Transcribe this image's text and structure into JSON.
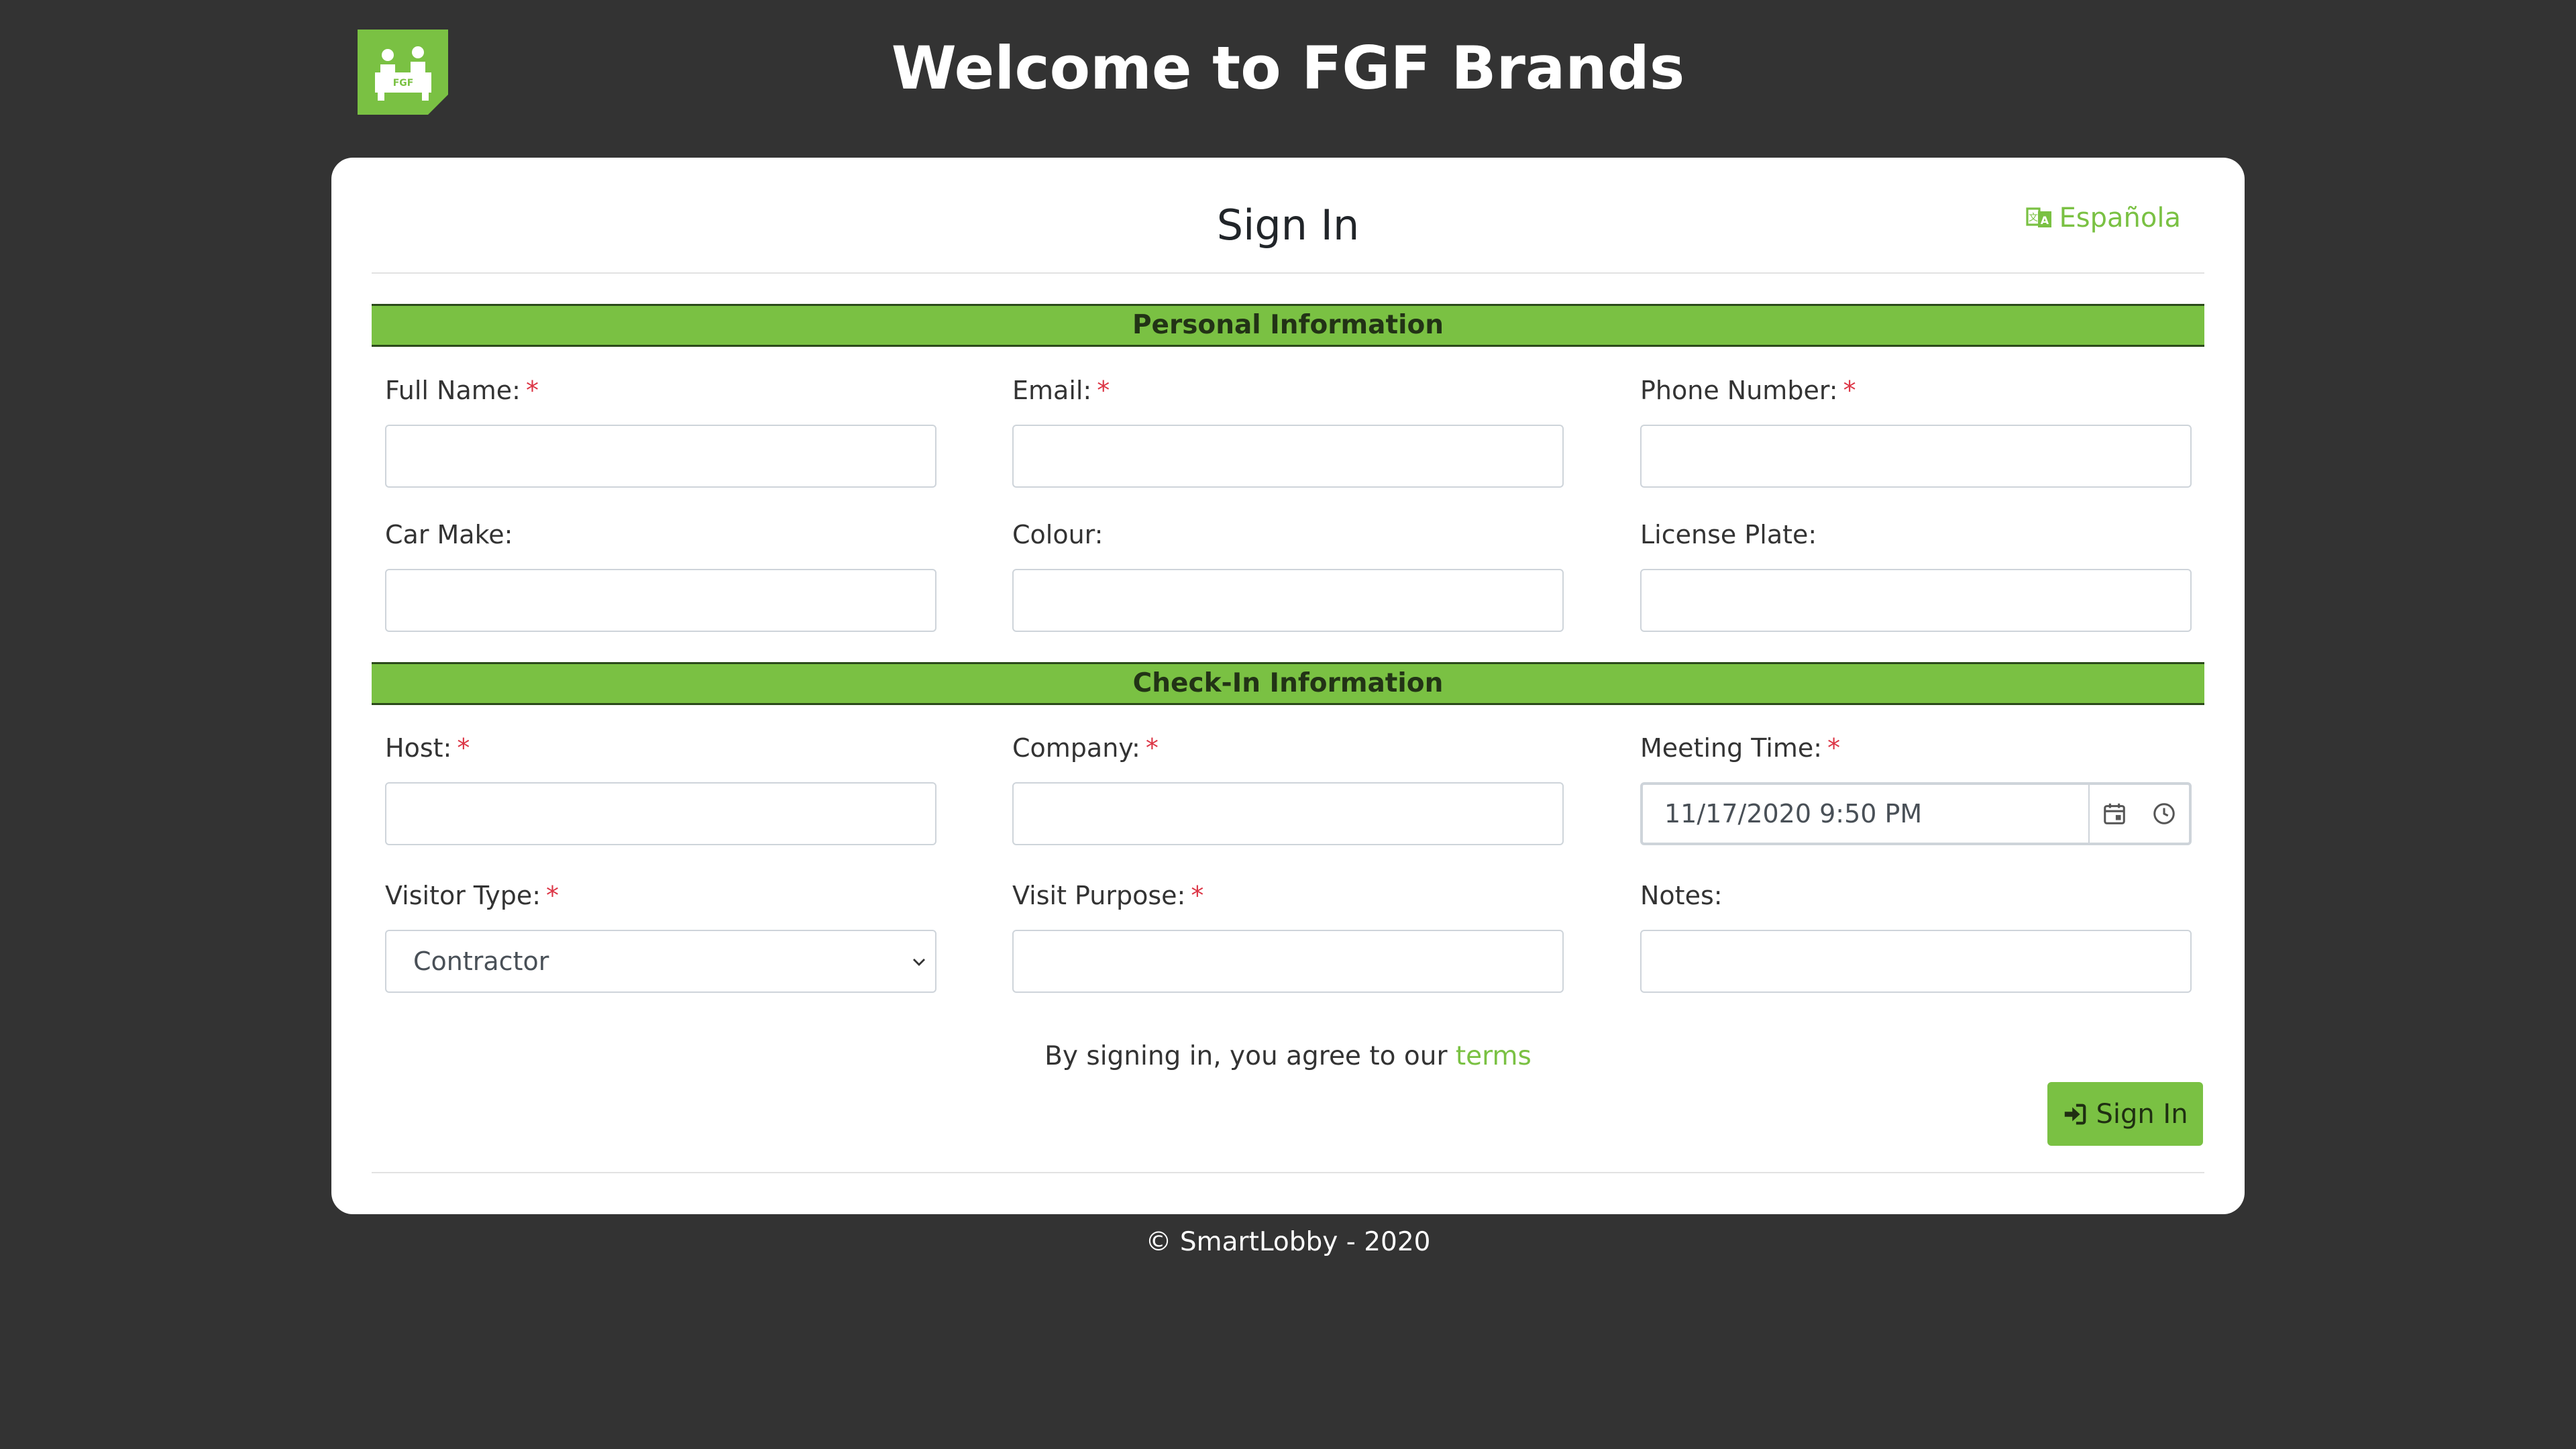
{
  "header": {
    "title": "Welcome to FGF Brands",
    "logo_text": "FGF",
    "logo_color": "#7ac143"
  },
  "card": {
    "title": "Sign In",
    "language_link": "Española",
    "language_icon": "language-icon"
  },
  "sections": {
    "personal": "Personal Information",
    "checkin": "Check-In Information"
  },
  "required_marker": "*",
  "fields": {
    "full_name": {
      "label": "Full Name:",
      "required": true,
      "value": ""
    },
    "email": {
      "label": "Email:",
      "required": true,
      "value": ""
    },
    "phone": {
      "label": "Phone Number:",
      "required": true,
      "value": ""
    },
    "car_make": {
      "label": "Car Make:",
      "required": false,
      "value": ""
    },
    "colour": {
      "label": "Colour:",
      "required": false,
      "value": ""
    },
    "license_plate": {
      "label": "License Plate:",
      "required": false,
      "value": ""
    },
    "host": {
      "label": "Host:",
      "required": true,
      "value": ""
    },
    "company": {
      "label": "Company:",
      "required": true,
      "value": ""
    },
    "meeting_time": {
      "label": "Meeting Time:",
      "required": true,
      "value": "11/17/2020 9:50 PM"
    },
    "visitor_type": {
      "label": "Visitor Type:",
      "required": true,
      "value": "Contractor"
    },
    "visit_purpose": {
      "label": "Visit Purpose:",
      "required": true,
      "value": ""
    },
    "notes": {
      "label": "Notes:",
      "required": false,
      "value": ""
    }
  },
  "terms": {
    "text": "By signing in, you agree to our ",
    "link": "terms"
  },
  "submit": {
    "label": "Sign In",
    "icon": "sign-in-icon"
  },
  "footer": {
    "text": "© SmartLobby - 2020"
  },
  "colors": {
    "accent": "#7ac143",
    "background": "#333333",
    "required": "#dc3545"
  }
}
